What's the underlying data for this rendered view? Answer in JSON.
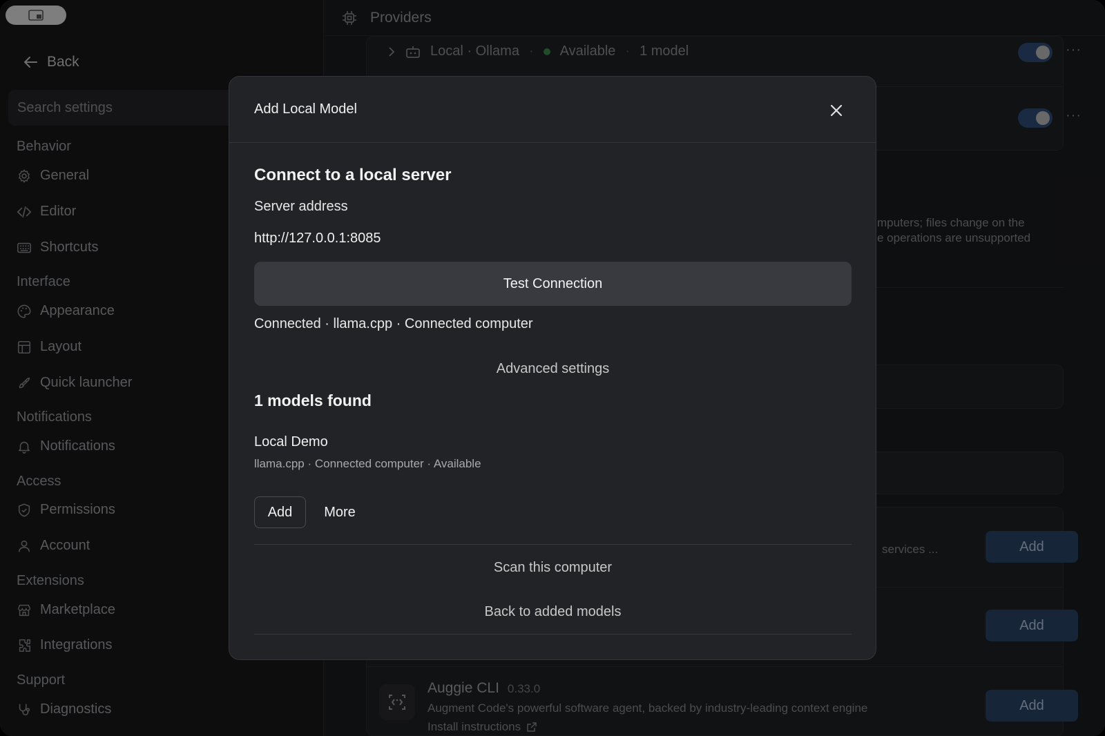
{
  "sidebar": {
    "back_label": "Back",
    "search_placeholder": "Search settings",
    "sections": {
      "behavior": "Behavior",
      "interface": "Interface",
      "notifications": "Notifications",
      "access": "Access",
      "extensions": "Extensions",
      "support": "Support"
    },
    "items": {
      "general": "General",
      "editor": "Editor",
      "shortcuts": "Shortcuts",
      "appearance": "Appearance",
      "layout": "Layout",
      "quick_launcher": "Quick launcher",
      "notifications": "Notifications",
      "permissions": "Permissions",
      "account": "Account",
      "marketplace": "Marketplace",
      "integrations": "Integrations",
      "diagnostics": "Diagnostics"
    }
  },
  "main": {
    "title": "Providers",
    "ollama": {
      "name": "Local · Ollama",
      "status": "Available",
      "models": "1 model"
    },
    "bg_text_1": "mputers; files change on the",
    "bg_text_2": "e operations are unsupported",
    "bg_text_3": "services ...",
    "add_label": "Add",
    "auggie": {
      "name": "Auggie CLI",
      "version": "0.33.0",
      "description": "Augment Code's powerful software agent, backed by industry-leading context engine",
      "install": "Install instructions"
    }
  },
  "modal": {
    "title": "Add Local Model",
    "connect_heading": "Connect to a local server",
    "server_address_label": "Server address",
    "server_address_value": "http://127.0.0.1:8085",
    "test_button": "Test Connection",
    "connection_status": "Connected · llama.cpp · Connected computer",
    "advanced_settings": "Advanced settings",
    "models_found": "1 models found",
    "model": {
      "name": "Local Demo",
      "meta": "llama.cpp · Connected computer · Available"
    },
    "add_button": "Add",
    "more_button": "More",
    "scan_link": "Scan this computer",
    "back_link": "Back to added models"
  },
  "colors": {
    "accent_button": "#2b4468",
    "toggle_on": "#2f4e78",
    "status_green": "#3c8a4f"
  }
}
